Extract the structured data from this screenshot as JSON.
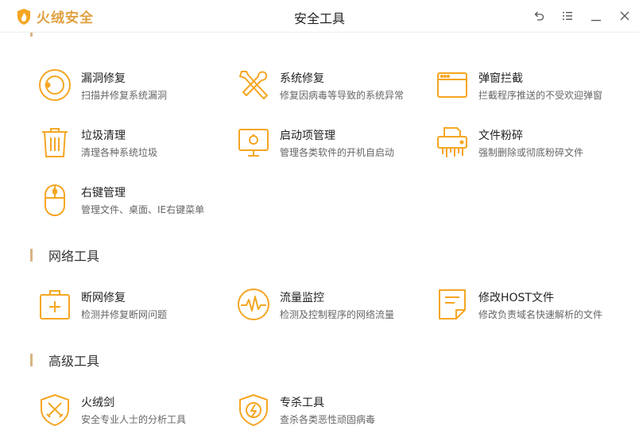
{
  "app": {
    "brand": "火绒安全",
    "window_title": "安全工具",
    "accent": "#f5a623"
  },
  "window_controls": [
    {
      "name": "back-button",
      "icon": "undo-icon"
    },
    {
      "name": "menu-button",
      "icon": "list-icon"
    },
    {
      "name": "minimize-button",
      "icon": "minimize-icon"
    },
    {
      "name": "close-button",
      "icon": "close-icon"
    }
  ],
  "sections": {
    "system": {
      "tools": [
        {
          "name": "漏洞修复",
          "desc": "扫描并修复系统漏洞",
          "icon": "vulnerability-icon"
        },
        {
          "name": "系统修复",
          "desc": "修复因病毒等导致的系统异常",
          "icon": "wrench-screwdriver-icon"
        },
        {
          "name": "弹窗拦截",
          "desc": "拦截程序推送的不受欢迎弹窗",
          "icon": "popup-window-icon"
        },
        {
          "name": "垃圾清理",
          "desc": "清理各种系统垃圾",
          "icon": "trash-icon"
        },
        {
          "name": "启动项管理",
          "desc": "管理各类软件的开机自启动",
          "icon": "monitor-startup-icon"
        },
        {
          "name": "文件粉碎",
          "desc": "强制删除或彻底粉碎文件",
          "icon": "shredder-icon"
        },
        {
          "name": "右键管理",
          "desc": "管理文件、桌面、IE右键菜单",
          "icon": "mouse-icon"
        }
      ]
    },
    "network": {
      "title": "网络工具",
      "tools": [
        {
          "name": "断网修复",
          "desc": "检测并修复断网问题",
          "icon": "first-aid-kit-icon"
        },
        {
          "name": "流量监控",
          "desc": "检测及控制程序的网络流量",
          "icon": "traffic-monitor-icon"
        },
        {
          "name": "修改HOST文件",
          "desc": "修改负责域名快速解析的文件",
          "icon": "host-file-icon"
        }
      ]
    },
    "advanced": {
      "title": "高级工具",
      "tools": [
        {
          "name": "火绒剑",
          "desc": "安全专业人士的分析工具",
          "icon": "sword-shield-icon"
        },
        {
          "name": "专杀工具",
          "desc": "查杀各类恶性顽固病毒",
          "icon": "virus-kill-shield-icon"
        }
      ]
    }
  }
}
